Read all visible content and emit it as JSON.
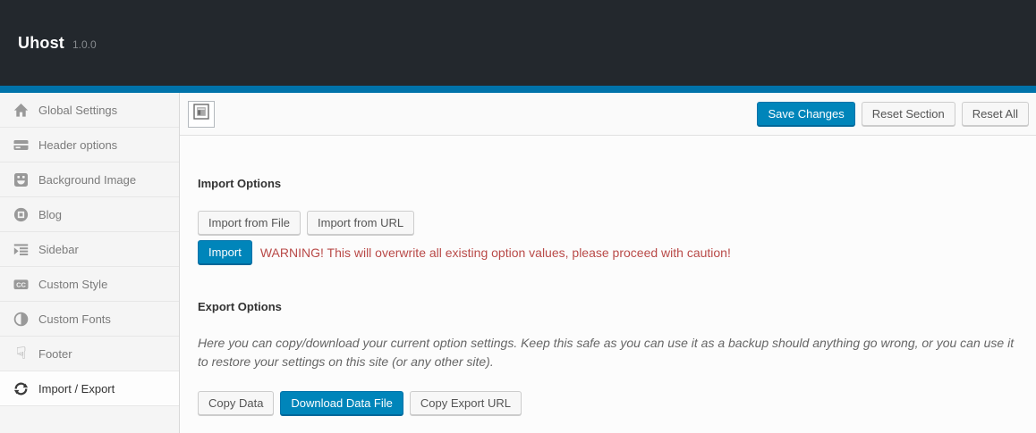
{
  "app": {
    "title": "Uhost",
    "version": "1.0.0"
  },
  "colors": {
    "header_dark": "#23282d",
    "accent_blue": "#0073aa",
    "button_blue": "#0085ba",
    "warning_red": "#b94a48"
  },
  "toolbar": {
    "expand_icon": "expand-options-icon",
    "save_label": "Save Changes",
    "reset_section_label": "Reset Section",
    "reset_all_label": "Reset All"
  },
  "sidebar": {
    "items": [
      {
        "label": "Global Settings",
        "icon": "home-icon",
        "active": false
      },
      {
        "label": "Header options",
        "icon": "header-card-icon",
        "active": false
      },
      {
        "label": "Background Image",
        "icon": "smiley-image-icon",
        "active": false
      },
      {
        "label": "Blog",
        "icon": "record-circle-icon",
        "active": false
      },
      {
        "label": "Sidebar",
        "icon": "indent-list-icon",
        "active": false
      },
      {
        "label": "Custom Style",
        "icon": "cc-badge-icon",
        "active": false
      },
      {
        "label": "Custom Fonts",
        "icon": "contrast-icon",
        "active": false
      },
      {
        "label": "Footer",
        "icon": "hand-down-icon",
        "active": false
      },
      {
        "label": "Import / Export",
        "icon": "refresh-icon",
        "active": true
      }
    ]
  },
  "import_section": {
    "heading": "Import Options",
    "import_from_file_label": "Import from File",
    "import_from_url_label": "Import from URL",
    "import_label": "Import",
    "warning": "WARNING! This will overwrite all existing option values, please proceed with caution!"
  },
  "export_section": {
    "heading": "Export Options",
    "description": "Here you can copy/download your current option settings. Keep this safe as you can use it as a backup should anything go wrong, or you can use it to restore your settings on this site (or any other site).",
    "copy_data_label": "Copy Data",
    "download_label": "Download Data File",
    "copy_url_label": "Copy Export URL"
  }
}
